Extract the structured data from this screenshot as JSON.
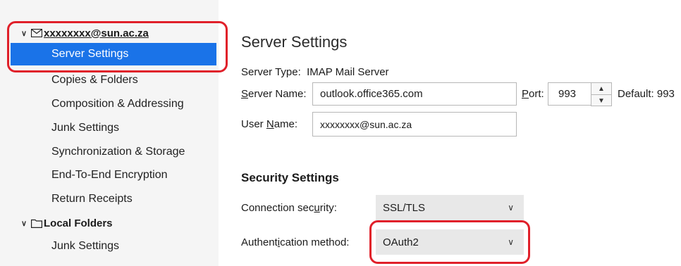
{
  "sidebar": {
    "account": "xxxxxxxx@sun.ac.za",
    "items": [
      {
        "label": "Server Settings",
        "selected": true
      },
      {
        "label": "Copies & Folders"
      },
      {
        "label": "Composition & Addressing"
      },
      {
        "label": "Junk Settings"
      },
      {
        "label": "Synchronization & Storage"
      },
      {
        "label": "End-To-End Encryption"
      },
      {
        "label": "Return Receipts"
      }
    ],
    "local_folders": "Local Folders",
    "local_items": [
      {
        "label": "Junk Settings"
      }
    ]
  },
  "main": {
    "title": "Server Settings",
    "server_type_label": "Server Type:",
    "server_type_value": "IMAP Mail Server",
    "server_name_label_pre": "",
    "server_name_label_u": "S",
    "server_name_label_post": "erver Name:",
    "server_name_value": "outlook.office365.com",
    "port_label_u": "P",
    "port_label_post": "ort:",
    "port_value": "993",
    "port_default": "Default: 993",
    "user_name_label_pre": "User ",
    "user_name_label_u": "N",
    "user_name_label_post": "ame:",
    "user_name_value": "xxxxxxxx@sun.ac.za",
    "security_heading": "Security Settings",
    "conn_sec_label_pre": "Connection sec",
    "conn_sec_label_u": "u",
    "conn_sec_label_post": "rity:",
    "conn_sec_value": "SSL/TLS",
    "auth_label_pre": "Authent",
    "auth_label_u": "i",
    "auth_label_post": "cation method:",
    "auth_value": "OAuth2"
  },
  "colors": {
    "selected": "#1a73e8",
    "highlight": "#e0202a"
  }
}
